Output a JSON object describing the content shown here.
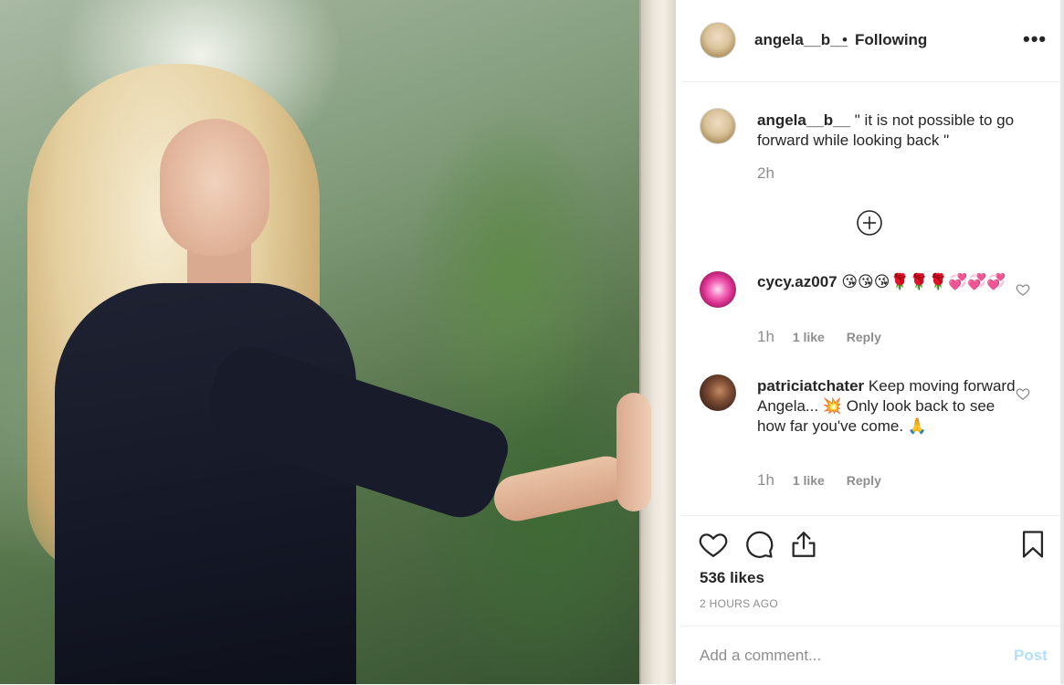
{
  "post": {
    "author": "angela__b__",
    "separator": "•",
    "follow_status": "Following",
    "more_icon": "•••"
  },
  "caption": {
    "user": "angela__b__",
    "text": " \" it is not possible to go forward while looking back \"",
    "time": "2h"
  },
  "comments": [
    {
      "user": "cycy.az007",
      "text": " 😘😘😘🌹🌹🌹💞💞💞",
      "time": "1h",
      "likes": "1 like",
      "reply": "Reply"
    },
    {
      "user": "patriciatchater",
      "text": " Keep moving forward Angela... 💥 Only look back to see how far you've come. 🙏",
      "time": "1h",
      "likes": "1 like",
      "reply": "Reply"
    }
  ],
  "stats": {
    "likes": "536 likes",
    "timestamp": "2 HOURS AGO"
  },
  "comment_box": {
    "placeholder": "Add a comment...",
    "post_label": "Post"
  },
  "colors": {
    "text": "#262626",
    "muted": "#8e8e8e",
    "post_disabled": "#b2dffc",
    "border": "#efefef"
  },
  "icons": {
    "more": "more-options-icon",
    "load_more": "plus-circle-icon",
    "like": "heart-icon",
    "comment": "comment-bubble-icon",
    "share": "share-icon",
    "save": "bookmark-icon"
  }
}
